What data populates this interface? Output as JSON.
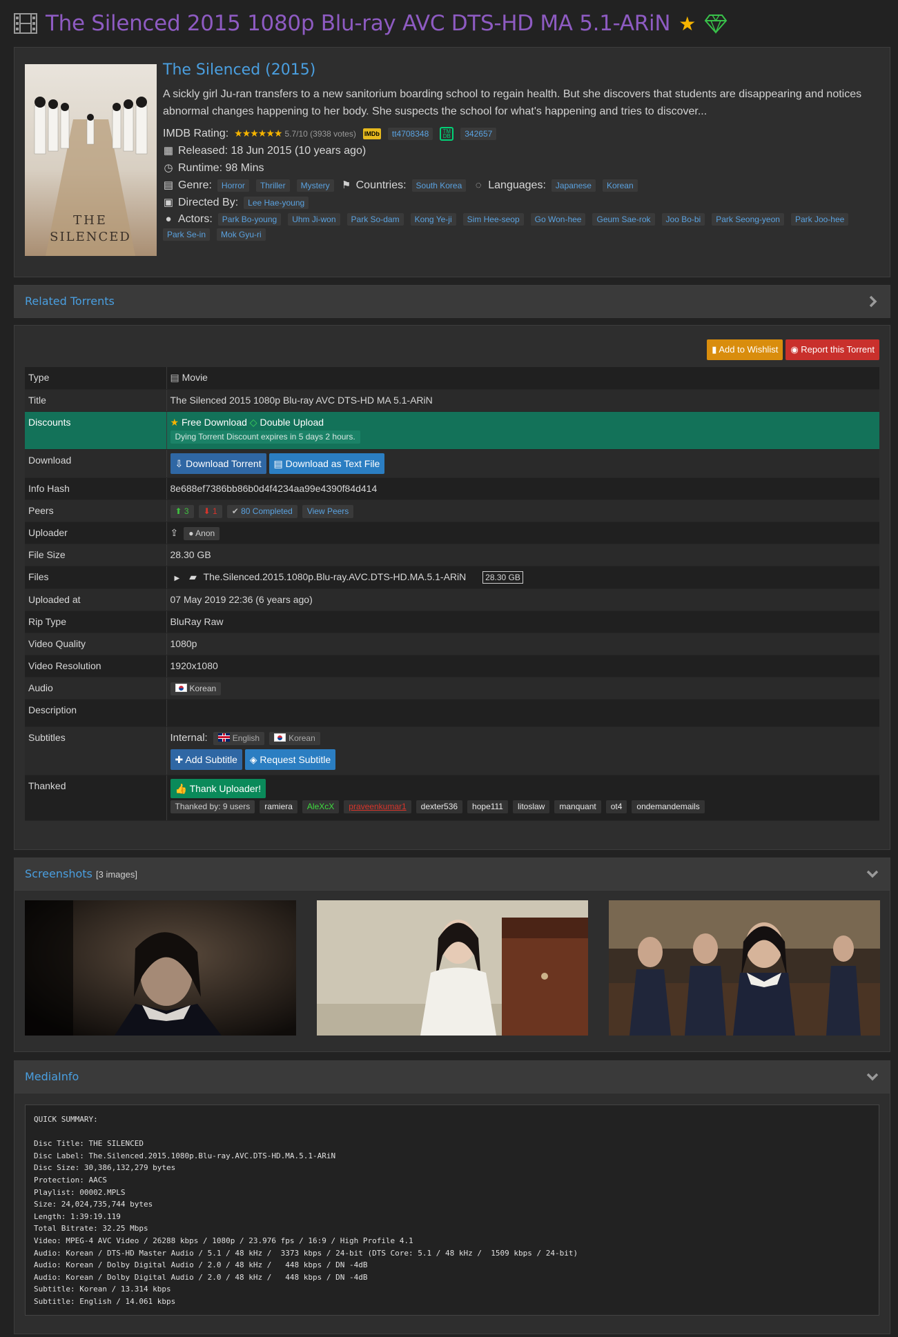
{
  "header": {
    "title": "The Silenced 2015 1080p Blu-ray AVC DTS-HD MA 5.1-ARiN"
  },
  "movie": {
    "title": "The Silenced (2015)",
    "overview": "A sickly girl Ju-ran transfers to a new sanitorium boarding school to regain health. But she discovers that students are disappearing and notices abnormal changes happening to her body. She suspects the school for what's happening and tries to discover...",
    "imdb_label": "IMDB Rating:",
    "stars": "★★★★★★",
    "rating_text": "5.7/10 (3938 votes)",
    "imdb_logo": "IMDb",
    "imdb_id": "tt4708348",
    "tmdb_logo": "TM DB",
    "tmdb_id": "342657",
    "released": "Released: 18 Jun 2015 (10 years ago)",
    "runtime": "Runtime: 98 Mins",
    "genre_label": "Genre:",
    "genres": [
      "Horror",
      "Thriller",
      "Mystery"
    ],
    "countries_label": "Countries:",
    "countries": [
      "South Korea"
    ],
    "languages_label": "Languages:",
    "languages": [
      "Japanese",
      "Korean"
    ],
    "directed_label": "Directed By:",
    "director": "Lee Hae-young",
    "actors_label": "Actors:",
    "actors": [
      "Park Bo-young",
      "Uhm Ji-won",
      "Park So-dam",
      "Kong Ye-ji",
      "Sim Hee-seop",
      "Go Won-hee",
      "Geum Sae-rok",
      "Joo Bo-bi",
      "Park Seong-yeon",
      "Park Joo-hee",
      "Park Se-in",
      "Mok Gyu-ri"
    ]
  },
  "related": {
    "title": "Related Torrents"
  },
  "actions": {
    "wishlist": "Add to Wishlist",
    "report": "Report this Torrent"
  },
  "details": {
    "type_k": "Type",
    "type_v": "Movie",
    "title_k": "Title",
    "title_v": "The Silenced 2015 1080p Blu-ray AVC DTS-HD MA 5.1-ARiN",
    "discounts_k": "Discounts",
    "free": "Free Download",
    "double": "Double Upload",
    "discount_note": "Dying Torrent Discount expires in 5 days 2 hours.",
    "download_k": "Download",
    "dl_torrent": "Download Torrent",
    "dl_text": "Download as Text File",
    "hash_k": "Info Hash",
    "hash_v": "8e688ef7386bb86b0d4f4234aa99e4390f84d414",
    "peers_k": "Peers",
    "seeders": "3",
    "leechers": "1",
    "completed": "80 Completed",
    "view_peers": "View Peers",
    "uploader_k": "Uploader",
    "uploader_v": "Anon",
    "size_k": "File Size",
    "size_v": "28.30 GB",
    "files_k": "Files",
    "files_name": "The.Silenced.2015.1080p.Blu-ray.AVC.DTS-HD.MA.5.1-ARiN",
    "files_size": "28.30 GB",
    "uploaded_k": "Uploaded at",
    "uploaded_v": "07 May 2019 22:36 (6 years ago)",
    "rip_k": "Rip Type",
    "rip_v": "BluRay Raw",
    "quality_k": "Video Quality",
    "quality_v": "1080p",
    "res_k": "Video Resolution",
    "res_v": "1920x1080",
    "audio_k": "Audio",
    "audio_v": "Korean",
    "desc_k": "Description",
    "subs_k": "Subtitles",
    "subs_internal": "Internal:",
    "sub_en": "English",
    "sub_ko": "Korean",
    "add_sub": "Add Subtitle",
    "req_sub": "Request Subtitle",
    "thanked_k": "Thanked",
    "thank_btn": "Thank Uploader!",
    "thanked_by": "Thanked by: 9 users",
    "thank_users": [
      "ramiera",
      "AleXcX",
      "praveenkumar1",
      "dexter536",
      "hope111",
      "litoslaw",
      "manquant",
      "ot4",
      "ondemandemails"
    ]
  },
  "screenshots": {
    "title": "Screenshots",
    "count": "[3 images]"
  },
  "mediainfo": {
    "title": "MediaInfo",
    "text": "QUICK SUMMARY:\n\nDisc Title: THE SILENCED\nDisc Label: The.Silenced.2015.1080p.Blu-ray.AVC.DTS-HD.MA.5.1-ARiN\nDisc Size: 30,386,132,279 bytes\nProtection: AACS\nPlaylist: 00002.MPLS\nSize: 24,024,735,744 bytes\nLength: 1:39:19.119\nTotal Bitrate: 32.25 Mbps\nVideo: MPEG-4 AVC Video / 26288 kbps / 1080p / 23.976 fps / 16:9 / High Profile 4.1\nAudio: Korean / DTS-HD Master Audio / 5.1 / 48 kHz /  3373 kbps / 24-bit (DTS Core: 5.1 / 48 kHz /  1509 kbps / 24-bit)\nAudio: Korean / Dolby Digital Audio / 2.0 / 48 kHz /   448 kbps / DN -4dB\nAudio: Korean / Dolby Digital Audio / 2.0 / 48 kHz /   448 kbps / DN -4dB\nSubtitle: Korean / 13.314 kbps\nSubtitle: English / 14.061 kbps"
  },
  "colors": {
    "accent": "#4a9fe0",
    "title_purple": "#8e5bc2",
    "discount_row": "#137259"
  }
}
